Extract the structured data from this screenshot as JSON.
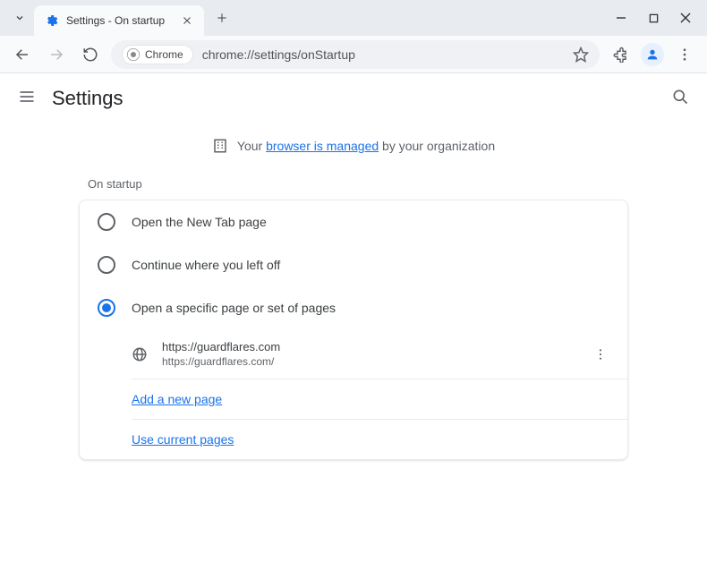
{
  "titlebar": {
    "tab_title": "Settings - On startup"
  },
  "omnibox": {
    "chip_label": "Chrome",
    "url": "chrome://settings/onStartup"
  },
  "header": {
    "title": "Settings"
  },
  "banner": {
    "prefix": "Your ",
    "link": "browser is managed",
    "suffix": " by your organization"
  },
  "section": {
    "title": "On startup"
  },
  "options": {
    "opt1": "Open the New Tab page",
    "opt2": "Continue where you left off",
    "opt3": "Open a specific page or set of pages"
  },
  "page_entry": {
    "title": "https://guardflares.com",
    "url": "https://guardflares.com/"
  },
  "actions": {
    "add_page": "Add a new page",
    "use_current": "Use current pages"
  }
}
